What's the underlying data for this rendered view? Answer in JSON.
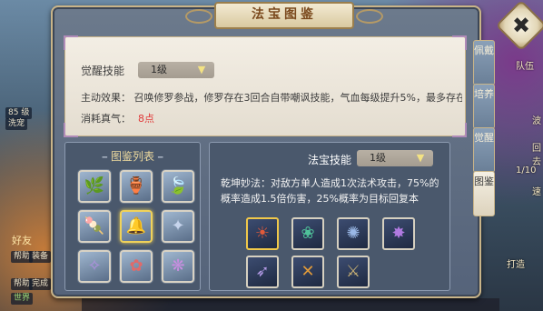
{
  "dialog": {
    "title": "法宝图鉴",
    "close_symbol": "✖"
  },
  "top_panel": {
    "awaken_label": "觉醒技能",
    "awaken_level": "1级",
    "effect_label": "主动效果：",
    "effect_text": "召唤修罗参战，修罗存在3回合自带嘲讽技能，气血每级提升5%，最多存在",
    "cost_label": "消耗真气：",
    "cost_value": "8点"
  },
  "side_tabs": [
    "佩戴",
    "培养",
    "觉醒",
    "图鉴"
  ],
  "list_panel": {
    "title": "图鉴列表",
    "items": [
      {
        "name": "item-1",
        "glyph": "🌿",
        "color": "#7fbf5a"
      },
      {
        "name": "item-2",
        "glyph": "🏺",
        "color": "#3b6b6e"
      },
      {
        "name": "item-3",
        "glyph": "🍃",
        "color": "#69b06a"
      },
      {
        "name": "item-4",
        "glyph": "🍡",
        "color": "#e0a27a"
      },
      {
        "name": "item-5",
        "glyph": "🔔",
        "color": "#b7c7e0"
      },
      {
        "name": "item-6",
        "glyph": "✦",
        "color": "#c6d4ec"
      },
      {
        "name": "item-7",
        "glyph": "✧",
        "color": "#b08fe0"
      },
      {
        "name": "item-8",
        "glyph": "✿",
        "color": "#e06a6a"
      },
      {
        "name": "item-9",
        "glyph": "❋",
        "color": "#c88ee0"
      }
    ]
  },
  "skill_panel": {
    "label": "法宝技能",
    "level": "1级",
    "desc_name": "乾坤妙法：",
    "desc_text": "对敌方单人造成1次法术攻击，75%的概率造成1.5倍伤害，25%概率为目标回复本",
    "skills": [
      {
        "name": "skill-1",
        "glyph": "☀",
        "color": "#e05a3a"
      },
      {
        "name": "skill-2",
        "glyph": "❀",
        "color": "#4fc29a"
      },
      {
        "name": "skill-3",
        "glyph": "✺",
        "color": "#9ab8e6"
      },
      {
        "name": "skill-4",
        "glyph": "✸",
        "color": "#b07ae0"
      },
      {
        "name": "skill-5",
        "glyph": "➶",
        "color": "#b39ae6"
      },
      {
        "name": "skill-6",
        "glyph": "✕",
        "color": "#e09a3a"
      },
      {
        "name": "skill-7",
        "glyph": "⚔",
        "color": "#c8b074"
      }
    ]
  },
  "background": {
    "left_items": [
      "85 级",
      "洗宠",
      "好友",
      "帮助",
      "装备",
      "世界",
      "帮助",
      "完成"
    ],
    "right_items": [
      "队伍",
      "波",
      "回去",
      "1/10",
      "速",
      "打造"
    ]
  }
}
